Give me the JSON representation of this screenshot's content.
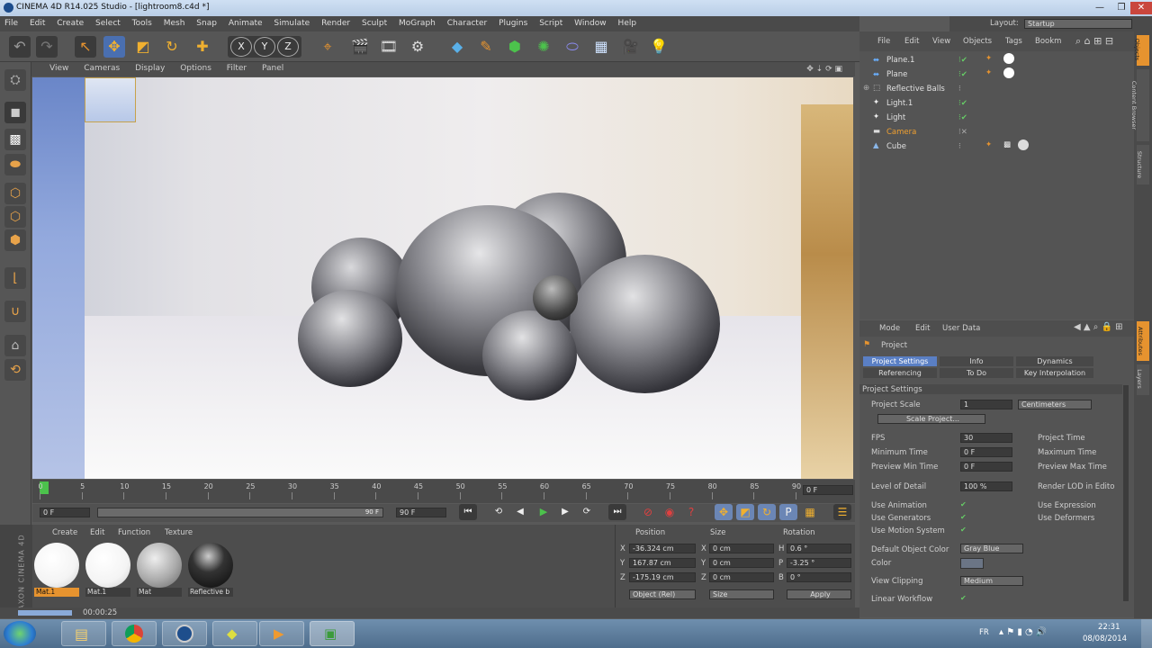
{
  "window": {
    "title": "CINEMA 4D R14.025 Studio - [lightroom8.c4d *]",
    "minimize": "—",
    "maximize": "❐",
    "close": "✕"
  },
  "menu": [
    "File",
    "Edit",
    "Create",
    "Select",
    "Tools",
    "Mesh",
    "Snap",
    "Animate",
    "Simulate",
    "Render",
    "Sculpt",
    "MoGraph",
    "Character",
    "Plugins",
    "Script",
    "Window",
    "Help"
  ],
  "layout": {
    "label": "Layout:",
    "value": "Startup"
  },
  "toolbar_axes": [
    "X",
    "Y",
    "Z"
  ],
  "viewport_menu": [
    "View",
    "Cameras",
    "Display",
    "Options",
    "Filter",
    "Panel"
  ],
  "timeline": {
    "ticks": [
      "0",
      "5",
      "10",
      "15",
      "20",
      "25",
      "30",
      "35",
      "40",
      "45",
      "50",
      "55",
      "60",
      "65",
      "70",
      "75",
      "80",
      "85",
      "90"
    ],
    "current_frame": "0 F",
    "start": "0 F",
    "end": "90 F",
    "range_end": "90 F"
  },
  "materials": {
    "menu": [
      "Create",
      "Edit",
      "Function",
      "Texture"
    ],
    "items": [
      {
        "label": "Mat.1",
        "selected": true,
        "ball": "white"
      },
      {
        "label": "Mat.1",
        "selected": false,
        "ball": "white"
      },
      {
        "label": "Mat",
        "selected": false,
        "ball": "grey"
      },
      {
        "label": "Reflective b",
        "selected": false,
        "ball": "black"
      }
    ]
  },
  "coordinates": {
    "headers": [
      "Position",
      "Size",
      "Rotation"
    ],
    "rows": [
      {
        "axis": "X",
        "pos": "-36.324 cm",
        "size_axis": "X",
        "size": "0 cm",
        "rot_axis": "H",
        "rot": "0.6 °"
      },
      {
        "axis": "Y",
        "pos": "167.87 cm",
        "size_axis": "Y",
        "size": "0 cm",
        "rot_axis": "P",
        "rot": "-3.25 °"
      },
      {
        "axis": "Z",
        "pos": "-175.19 cm",
        "size_axis": "Z",
        "size": "0 cm",
        "rot_axis": "B",
        "rot": "0 °"
      }
    ],
    "mode_select": "Object (Rel)",
    "size_select": "Size",
    "apply": "Apply"
  },
  "status": {
    "time": "00:00:25"
  },
  "object_manager": {
    "menu": [
      "File",
      "Edit",
      "View",
      "Objects",
      "Tags",
      "Bookm"
    ],
    "objects": [
      {
        "name": "Plane.1",
        "highlight": false
      },
      {
        "name": "Plane",
        "highlight": false
      },
      {
        "name": "Reflective Balls",
        "highlight": false
      },
      {
        "name": "Light.1",
        "highlight": false
      },
      {
        "name": "Light",
        "highlight": false
      },
      {
        "name": "Camera",
        "highlight": true
      },
      {
        "name": "Cube",
        "highlight": false
      }
    ]
  },
  "attribute_manager": {
    "menu": [
      "Mode",
      "Edit",
      "User Data"
    ],
    "title": "Project",
    "tabs": [
      "Project Settings",
      "Info",
      "Dynamics",
      "Referencing",
      "To Do",
      "Key Interpolation"
    ],
    "section": "Project Settings",
    "project_scale_label": "Project Scale",
    "project_scale_value": "1",
    "project_scale_unit": "Centimeters",
    "scale_project_button": "Scale Project...",
    "fps_label": "FPS",
    "fps_value": "30",
    "project_time_label": "Project Time",
    "min_time_label": "Minimum Time",
    "min_time_value": "0 F",
    "max_time_label": "Maximum Time",
    "prev_min_label": "Preview Min Time",
    "prev_min_value": "0 F",
    "prev_max_label": "Preview Max Time",
    "lod_label": "Level of Detail",
    "lod_value": "100 %",
    "render_lod_label": "Render LOD in Edito",
    "use_anim_label": "Use Animation",
    "use_expr_label": "Use Expression",
    "use_gen_label": "Use Generators",
    "use_def_label": "Use Deformers",
    "use_motion_label": "Use Motion System",
    "default_color_label": "Default Object Color",
    "default_color_value": "Gray Blue",
    "color_label": "Color",
    "view_clip_label": "View Clipping",
    "view_clip_value": "Medium",
    "linear_label": "Linear Workflow"
  },
  "right_dock_tabs": [
    "Objects",
    "Content Browser",
    "Structure",
    "Attributes",
    "Layers"
  ],
  "taskbar": {
    "lang": "FR",
    "time": "22:31",
    "date": "08/08/2014"
  },
  "branding": "MAXON CINEMA 4D"
}
